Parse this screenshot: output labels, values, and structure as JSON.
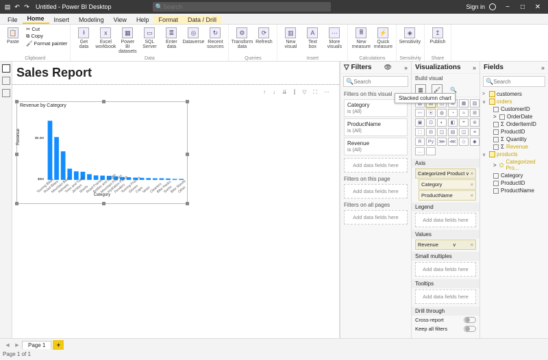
{
  "titlebar": {
    "title": "Untitled - Power BI Desktop",
    "search_placeholder": "Search",
    "signin": "Sign in",
    "minimize": "−",
    "restore": "□",
    "close": "✕"
  },
  "ribbon_tabs": [
    "File",
    "Home",
    "Insert",
    "Modeling",
    "View",
    "Help",
    "Format",
    "Data / Drill"
  ],
  "ribbon_tabs_active": 1,
  "ribbon_tabs_context_start": 6,
  "ribbon": {
    "clipboard": {
      "group": "Clipboard",
      "paste": "Paste",
      "cut": "Cut",
      "copy": "Copy",
      "fmt": "Format painter"
    },
    "data": {
      "group": "Data",
      "items": [
        {
          "lbl": "Get data",
          "ic": "⭳"
        },
        {
          "lbl": "Excel workbook",
          "ic": "x"
        },
        {
          "lbl": "Power BI datasets",
          "ic": "▦"
        },
        {
          "lbl": "SQL Server",
          "ic": "▭"
        },
        {
          "lbl": "Enter data",
          "ic": "≣"
        },
        {
          "lbl": "Dataverse",
          "ic": "◎"
        },
        {
          "lbl": "Recent sources",
          "ic": "↻"
        }
      ]
    },
    "queries": {
      "group": "Queries",
      "items": [
        {
          "lbl": "Transform data",
          "ic": "⚙"
        },
        {
          "lbl": "Refresh",
          "ic": "⟳"
        }
      ]
    },
    "insert": {
      "group": "Insert",
      "items": [
        {
          "lbl": "New visual",
          "ic": "▥"
        },
        {
          "lbl": "Text box",
          "ic": "A"
        },
        {
          "lbl": "More visuals",
          "ic": "⋯"
        }
      ]
    },
    "calc": {
      "group": "Calculations",
      "items": [
        {
          "lbl": "New measure",
          "ic": "🖩"
        },
        {
          "lbl": "Quick measure",
          "ic": "⚡"
        }
      ]
    },
    "sens": {
      "group": "Sensitivity",
      "items": [
        {
          "lbl": "Sensitivity",
          "ic": "◈"
        }
      ]
    },
    "share": {
      "group": "Share",
      "items": [
        {
          "lbl": "Publish",
          "ic": "↥"
        }
      ]
    }
  },
  "report_title": "Sales Report",
  "chart": {
    "title": "Revenue by Category",
    "ylabel": "Revenue",
    "xlabel": "Category"
  },
  "chart_data": {
    "type": "bar",
    "title": "Revenue by Category",
    "xlabel": "Category",
    "ylabel": "Revenue",
    "ylim": [
      0,
      0.3
    ],
    "y_unit": "M",
    "y_ticks": [
      "$0M",
      "$0.2M"
    ],
    "categories": [
      "Touring Bikes",
      "Road Bikes",
      "Mountain Bikes",
      "Helmets",
      "Tires and Tubes",
      "Jerseys",
      "Shorts",
      "Road Frames",
      "Bottles and Cages",
      "Mountain Frames",
      "Hydration Packs",
      "Fenders",
      "Touring Frames",
      "Gloves",
      "Caps",
      "Vests",
      "Cleaners",
      "Bike Racks",
      "Socks",
      "Bike Stands",
      "Other"
    ],
    "values": [
      0.29,
      0.21,
      0.14,
      0.055,
      0.042,
      0.04,
      0.028,
      0.022,
      0.021,
      0.02,
      0.018,
      0.014,
      0.013,
      0.011,
      0.01,
      0.009,
      0.008,
      0.008,
      0.007,
      0.005,
      0.005
    ]
  },
  "filters": {
    "header": "Filters",
    "search_placeholder": "Search",
    "on_visual": "Filters on this visual",
    "on_page": "Filters on this page",
    "on_all": "Filters on all pages",
    "add": "Add data fields here",
    "items": [
      {
        "name": "Category",
        "state": "is (All)"
      },
      {
        "name": "ProductName",
        "state": "is (All)"
      },
      {
        "name": "Revenue",
        "state": "is (All)"
      }
    ]
  },
  "visualizations": {
    "header": "Visualizations",
    "sub": "Build visual",
    "tooltip": "Stacked column chart",
    "sections": {
      "axis": "Axis",
      "legend": "Legend",
      "values": "Values",
      "sm": "Small multiples",
      "tooltips": "Tooltips",
      "drill": "Drill through",
      "cross": "Cross-report",
      "keep": "Keep all filters"
    },
    "axis_fields": [
      {
        "lbl": "Categorized Product",
        "close": true,
        "chev": true
      },
      {
        "lbl": "Category",
        "sub": true,
        "close": true
      },
      {
        "lbl": "ProductName",
        "sub": true,
        "close": true
      }
    ],
    "values_fields": [
      {
        "lbl": "Revenue",
        "close": true,
        "chev": true
      }
    ],
    "add": "Add data fields here",
    "cross_state": "Off"
  },
  "fields": {
    "header": "Fields",
    "search_placeholder": "Search",
    "tables": [
      {
        "name": "customers",
        "exp": ">",
        "cols": []
      },
      {
        "name": "orders",
        "exp": "∨",
        "checked": true,
        "cols": [
          {
            "name": "CustomerID"
          },
          {
            "name": "OrderDate",
            "exp": ">"
          },
          {
            "name": "OrderItemID",
            "sigma": true
          },
          {
            "name": "ProductID"
          },
          {
            "name": "Quantity",
            "sigma": true
          },
          {
            "name": "Revenue",
            "sigma": true,
            "checked": true
          }
        ]
      },
      {
        "name": "products",
        "exp": "∨",
        "checked": true,
        "cols": [
          {
            "name": "Categorized Pro...",
            "hier": true,
            "checked": true,
            "exp": ">"
          },
          {
            "name": "Category"
          },
          {
            "name": "ProductID"
          },
          {
            "name": "ProductName"
          }
        ]
      }
    ]
  },
  "pagebar": {
    "page": "Page 1",
    "add": "+"
  },
  "status": "Page 1 of 1",
  "viz_gallery_labels": [
    "▥",
    "▤",
    "◫",
    "≣",
    "▦",
    "▨",
    "〰",
    "⦿",
    "◍",
    "◔",
    "≈",
    "⊞",
    "▣",
    "⊡",
    "◐",
    "◧",
    "⌖",
    "⊚",
    "⬚",
    "⊟",
    "◫",
    "▤",
    "◫",
    "≡",
    "R",
    "Py",
    "⋙",
    "⋘",
    "◇",
    "◆",
    "…",
    ""
  ]
}
